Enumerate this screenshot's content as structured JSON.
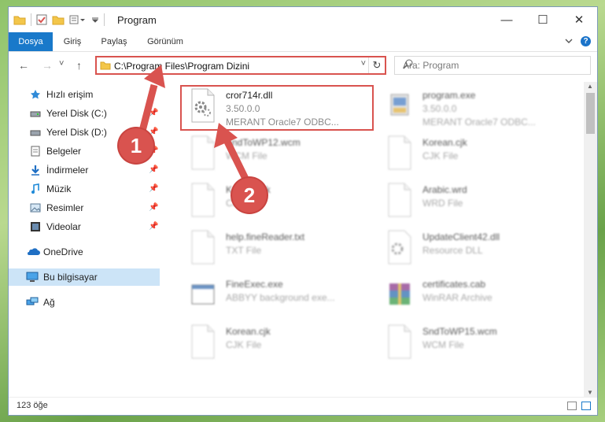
{
  "window": {
    "title": "Program",
    "controls": {
      "minimize": "—",
      "maximize": "☐",
      "close": "✕"
    }
  },
  "ribbon": {
    "tabs": [
      {
        "label": "Dosya",
        "active": true
      },
      {
        "label": "Giriş",
        "active": false
      },
      {
        "label": "Paylaş",
        "active": false
      },
      {
        "label": "Görünüm",
        "active": false
      }
    ],
    "expand_icon": "chevron-down-icon",
    "help_label": "?"
  },
  "nav": {
    "back": "←",
    "forward": "→",
    "recent": "˅",
    "up": "↑",
    "address": "C:\\Program Files\\Program Dizini",
    "dropdown": "˅",
    "refresh": "↻",
    "search_placeholder": "Ara: Program"
  },
  "sidebar": {
    "items": [
      {
        "label": "Hızlı erişim",
        "icon": "star-icon",
        "pinned": false
      },
      {
        "label": "Yerel Disk (C:)",
        "icon": "disk-icon",
        "pinned": true
      },
      {
        "label": "Yerel Disk (D:)",
        "icon": "disk-icon",
        "pinned": true
      },
      {
        "label": "Belgeler",
        "icon": "document-icon",
        "pinned": true
      },
      {
        "label": "İndirmeler",
        "icon": "download-icon",
        "pinned": true
      },
      {
        "label": "Müzik",
        "icon": "music-icon",
        "pinned": true
      },
      {
        "label": "Resimler",
        "icon": "pictures-icon",
        "pinned": true
      },
      {
        "label": "Videolar",
        "icon": "video-icon",
        "pinned": true
      },
      {
        "label": "OneDrive",
        "icon": "cloud-icon",
        "pinned": false
      },
      {
        "label": "Bu bilgisayar",
        "icon": "computer-icon",
        "pinned": false
      },
      {
        "label": "Ağ",
        "icon": "network-icon",
        "pinned": false
      }
    ]
  },
  "files": [
    {
      "name": "cror714r.dll",
      "line2": "3.50.0.0",
      "line3": "MERANT Oracle7 ODBC...",
      "icon": "dll-gear-icon",
      "highlighted": true
    },
    {
      "name": "program.exe",
      "line2": "3.50.0.0",
      "line3": "MERANT Oracle7 ODBC...",
      "icon": "exe-icon"
    },
    {
      "name": "SndToWP12.wcm",
      "line2": "WCM File",
      "line3": "",
      "icon": "blank-file-icon"
    },
    {
      "name": "Korean.cjk",
      "line2": "CJK File",
      "line3": "",
      "icon": "blank-file-icon"
    },
    {
      "name": "Korean.cjk",
      "line2": "CJK File",
      "line3": "",
      "icon": "blank-file-icon"
    },
    {
      "name": "Arabic.wrd",
      "line2": "WRD File",
      "line3": "",
      "icon": "blank-file-icon"
    },
    {
      "name": "help.fineReader.txt",
      "line2": "TXT File",
      "line3": "",
      "icon": "blank-file-icon"
    },
    {
      "name": "UpdateClient42.dll",
      "line2": "Resource DLL",
      "line3": "",
      "icon": "dll-gear-icon"
    },
    {
      "name": "FineExec.exe",
      "line2": "ABBYY background exe...",
      "line3": "",
      "icon": "window-exe-icon"
    },
    {
      "name": "certificates.cab",
      "line2": "WinRAR Archive",
      "line3": "",
      "icon": "winrar-icon"
    },
    {
      "name": "Korean.cjk",
      "line2": "CJK File",
      "line3": "",
      "icon": "blank-file-icon"
    },
    {
      "name": "SndToWP15.wcm",
      "line2": "WCM File",
      "line3": "",
      "icon": "blank-file-icon"
    }
  ],
  "annotations": {
    "step1": "1",
    "step2": "2",
    "color": "#d9534f"
  },
  "status": {
    "count": "123 öğe"
  }
}
